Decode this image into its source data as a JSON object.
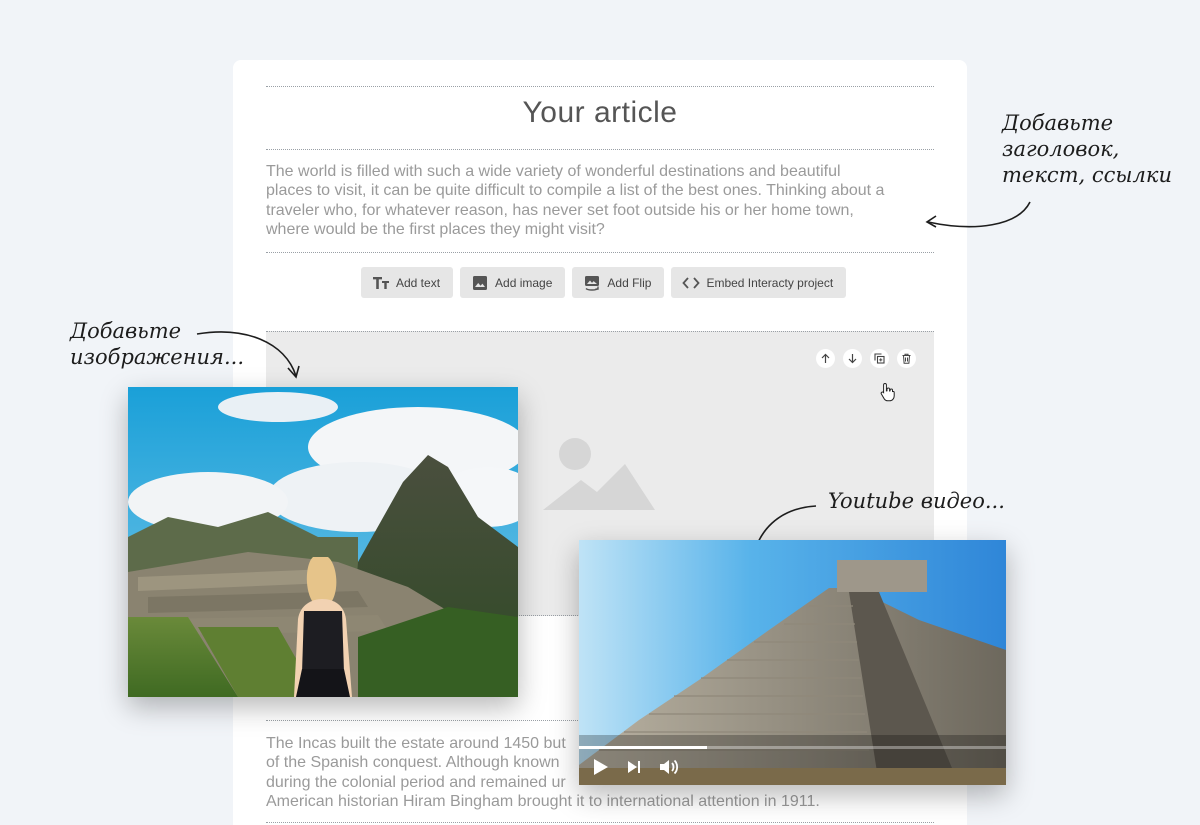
{
  "article": {
    "title": "Your article",
    "intro": "The world is filled with such a wide variety of wonderful destinations and beautiful places to visit, it can be quite difficult to compile a list of the best ones. Thinking about a traveler who, for whatever reason, has never set foot outside his or her home town, where would be the first places they might visit?",
    "body_line1": "The Incas built the estate around 1450 but",
    "body_line2": "of the Spanish conquest. Although known",
    "body_line3": "during the colonial period and remained ur",
    "body_line4": "American historian Hiram Bingham brought it to international attention in 1911."
  },
  "toolbar": {
    "add_text": "Add text",
    "add_image": "Add image",
    "add_flip": "Add Flip",
    "embed": "Embed Interacty project"
  },
  "block_controls": [
    "arrow-up-icon",
    "arrow-down-icon",
    "duplicate-icon",
    "trash-icon"
  ],
  "annotations": {
    "header_note_1": "Добавьте",
    "header_note_2": "заголовок,",
    "header_note_3": "текст, ссылки",
    "image_note_1": "Добавьте",
    "image_note_2": "изображения...",
    "video_note": "Youtube видео..."
  },
  "video": {
    "progress": 0.3
  },
  "colors": {
    "page_bg": "#f1f4f8",
    "card_bg": "#ffffff",
    "button_bg": "#e6e6e6",
    "text_muted": "#9a9a9a"
  }
}
